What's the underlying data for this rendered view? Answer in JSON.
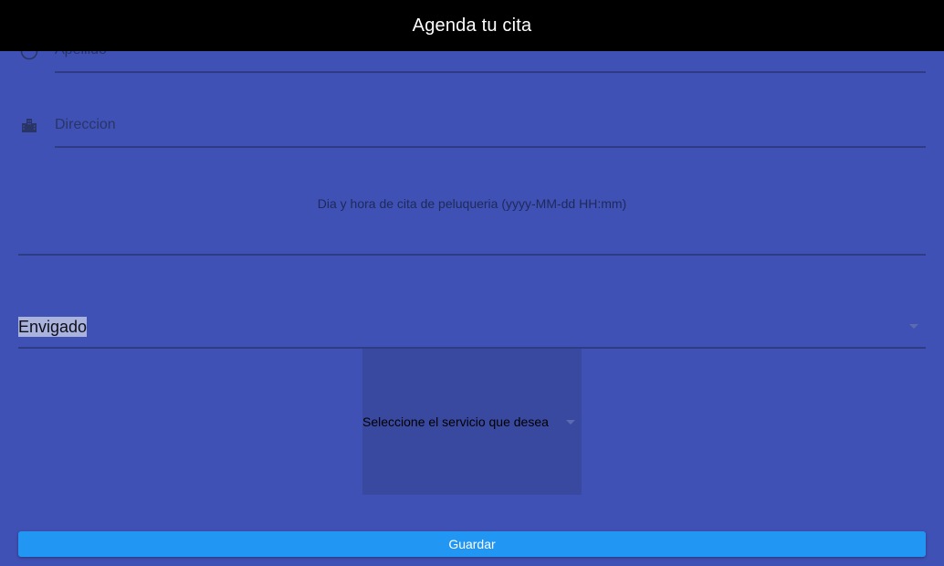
{
  "appbar": {
    "title": "Agenda tu cita"
  },
  "form": {
    "apellido_label": "Apellido",
    "direccion_label": "Direccion",
    "datetime_label": "Dia y hora de cita de peluqueria (yyyy-MM-dd HH:mm)",
    "city_value": "Envigado",
    "service_placeholder": "Seleccione el servicio que desea",
    "save_label": "Guardar"
  },
  "icons": {
    "apellido": "person-circle-icon",
    "direccion": "city-icon",
    "city_dropdown": "dropdown-arrow-icon",
    "service_dropdown": "dropdown-arrow-icon"
  },
  "colors": {
    "background": "#3f51b5",
    "appbar": "#000000",
    "button": "#2196f3",
    "service_box": "#3949a0"
  }
}
